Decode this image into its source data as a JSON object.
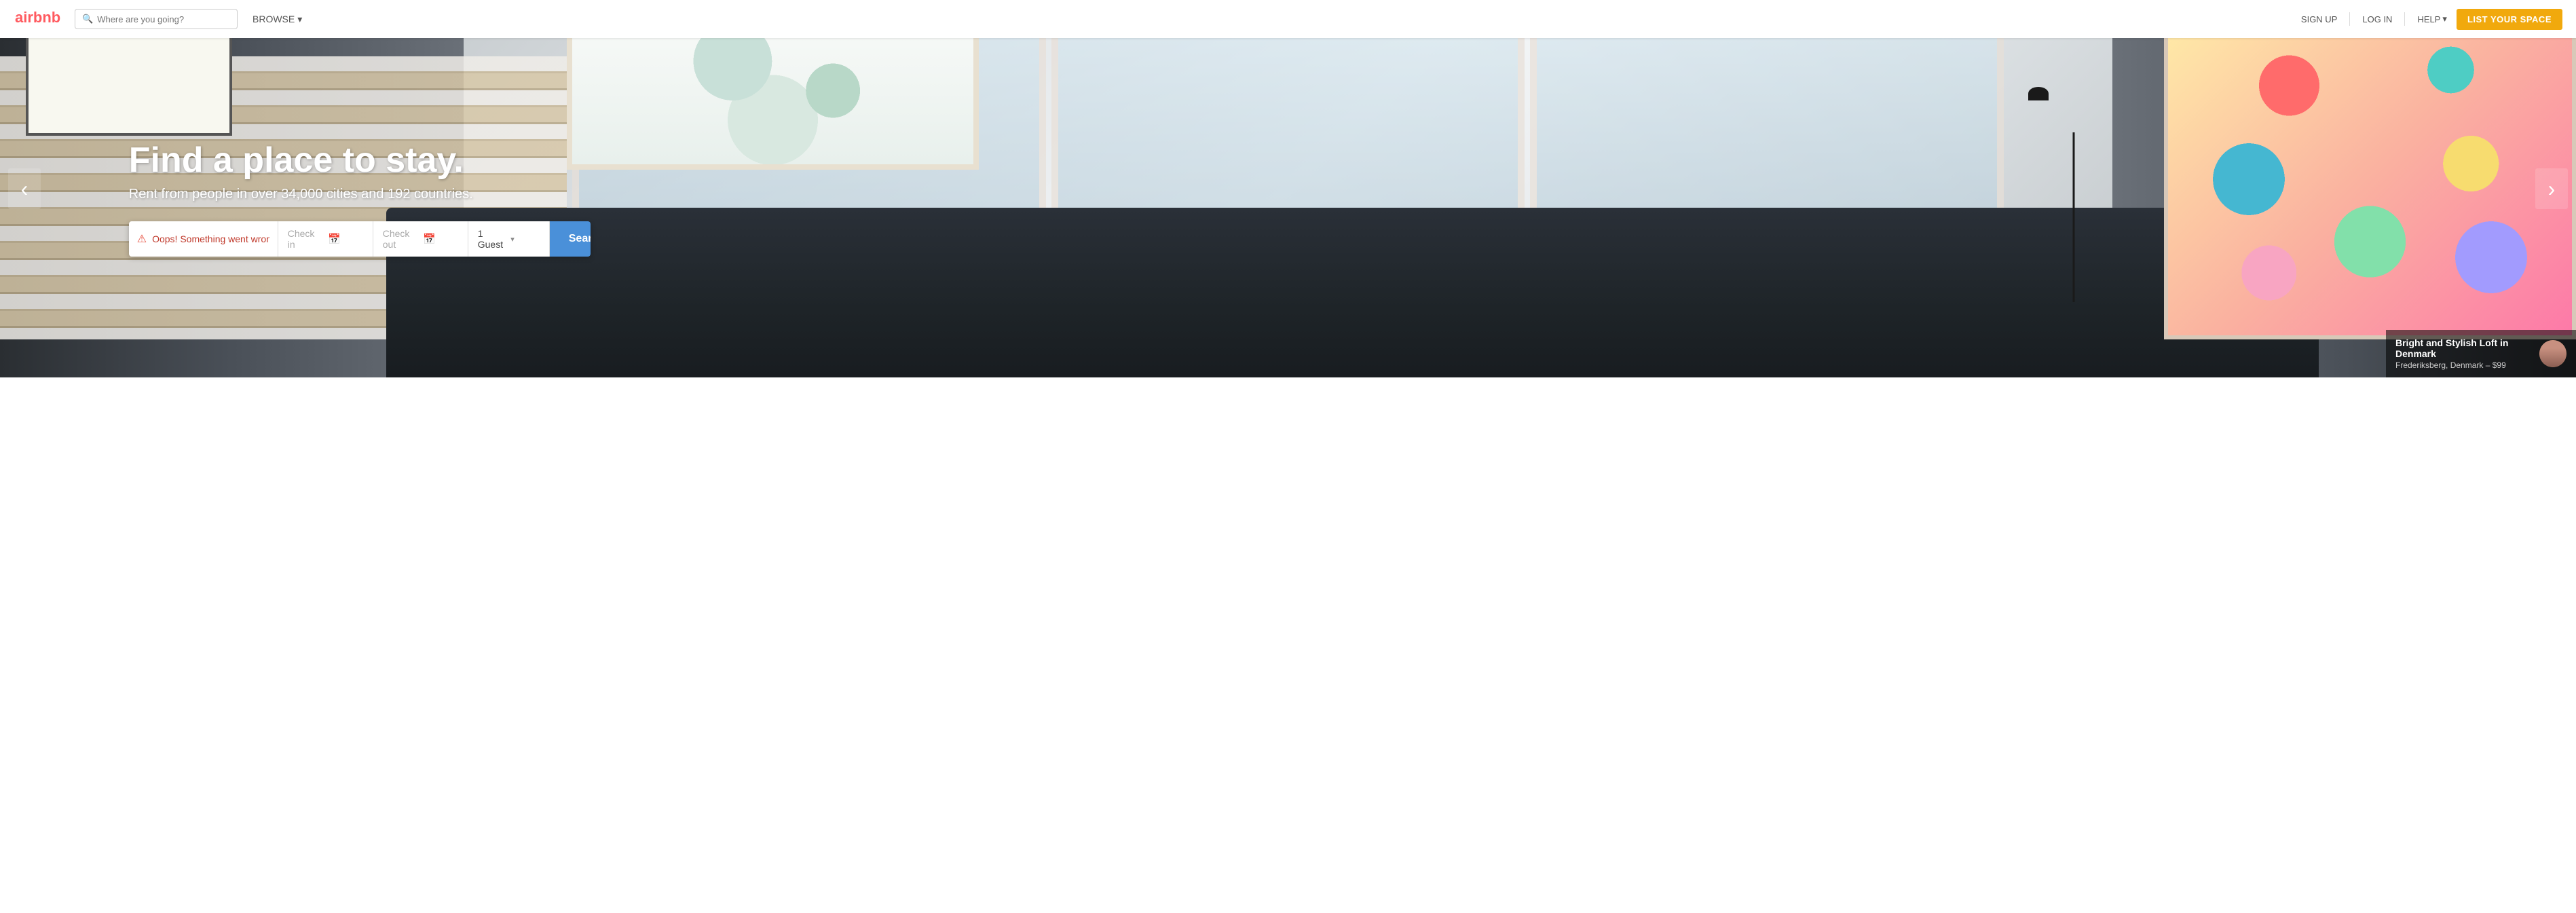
{
  "navbar": {
    "logo_alt": "Airbnb",
    "search_placeholder": "Where are you going?",
    "browse_label": "BROWSE",
    "signup_label": "SIGN UP",
    "login_label": "LOG IN",
    "help_label": "HELP",
    "list_space_label": "LIST YOUR SPACE"
  },
  "hero": {
    "title": "Find a place to stay.",
    "subtitle": "Rent from people in over 34,000 cities and 192 countries.",
    "prev_arrow": "‹",
    "next_arrow": "›"
  },
  "search_form": {
    "location_error": "Oops! Something went wrong.",
    "checkin_label": "Check in",
    "checkout_label": "Check out",
    "guest_label": "1 Guest",
    "search_button": "Search",
    "checkin_placeholder": "Check in",
    "checkout_placeholder": "Check out"
  },
  "property_card": {
    "name": "Bright and Stylish Loft in Denmark",
    "location": "Frederiksberg, Denmark",
    "price": "$99"
  },
  "icons": {
    "search": "🔍",
    "calendar": "📅",
    "dropdown": "▾",
    "prev": "‹",
    "next": "›",
    "error": "⚠"
  }
}
